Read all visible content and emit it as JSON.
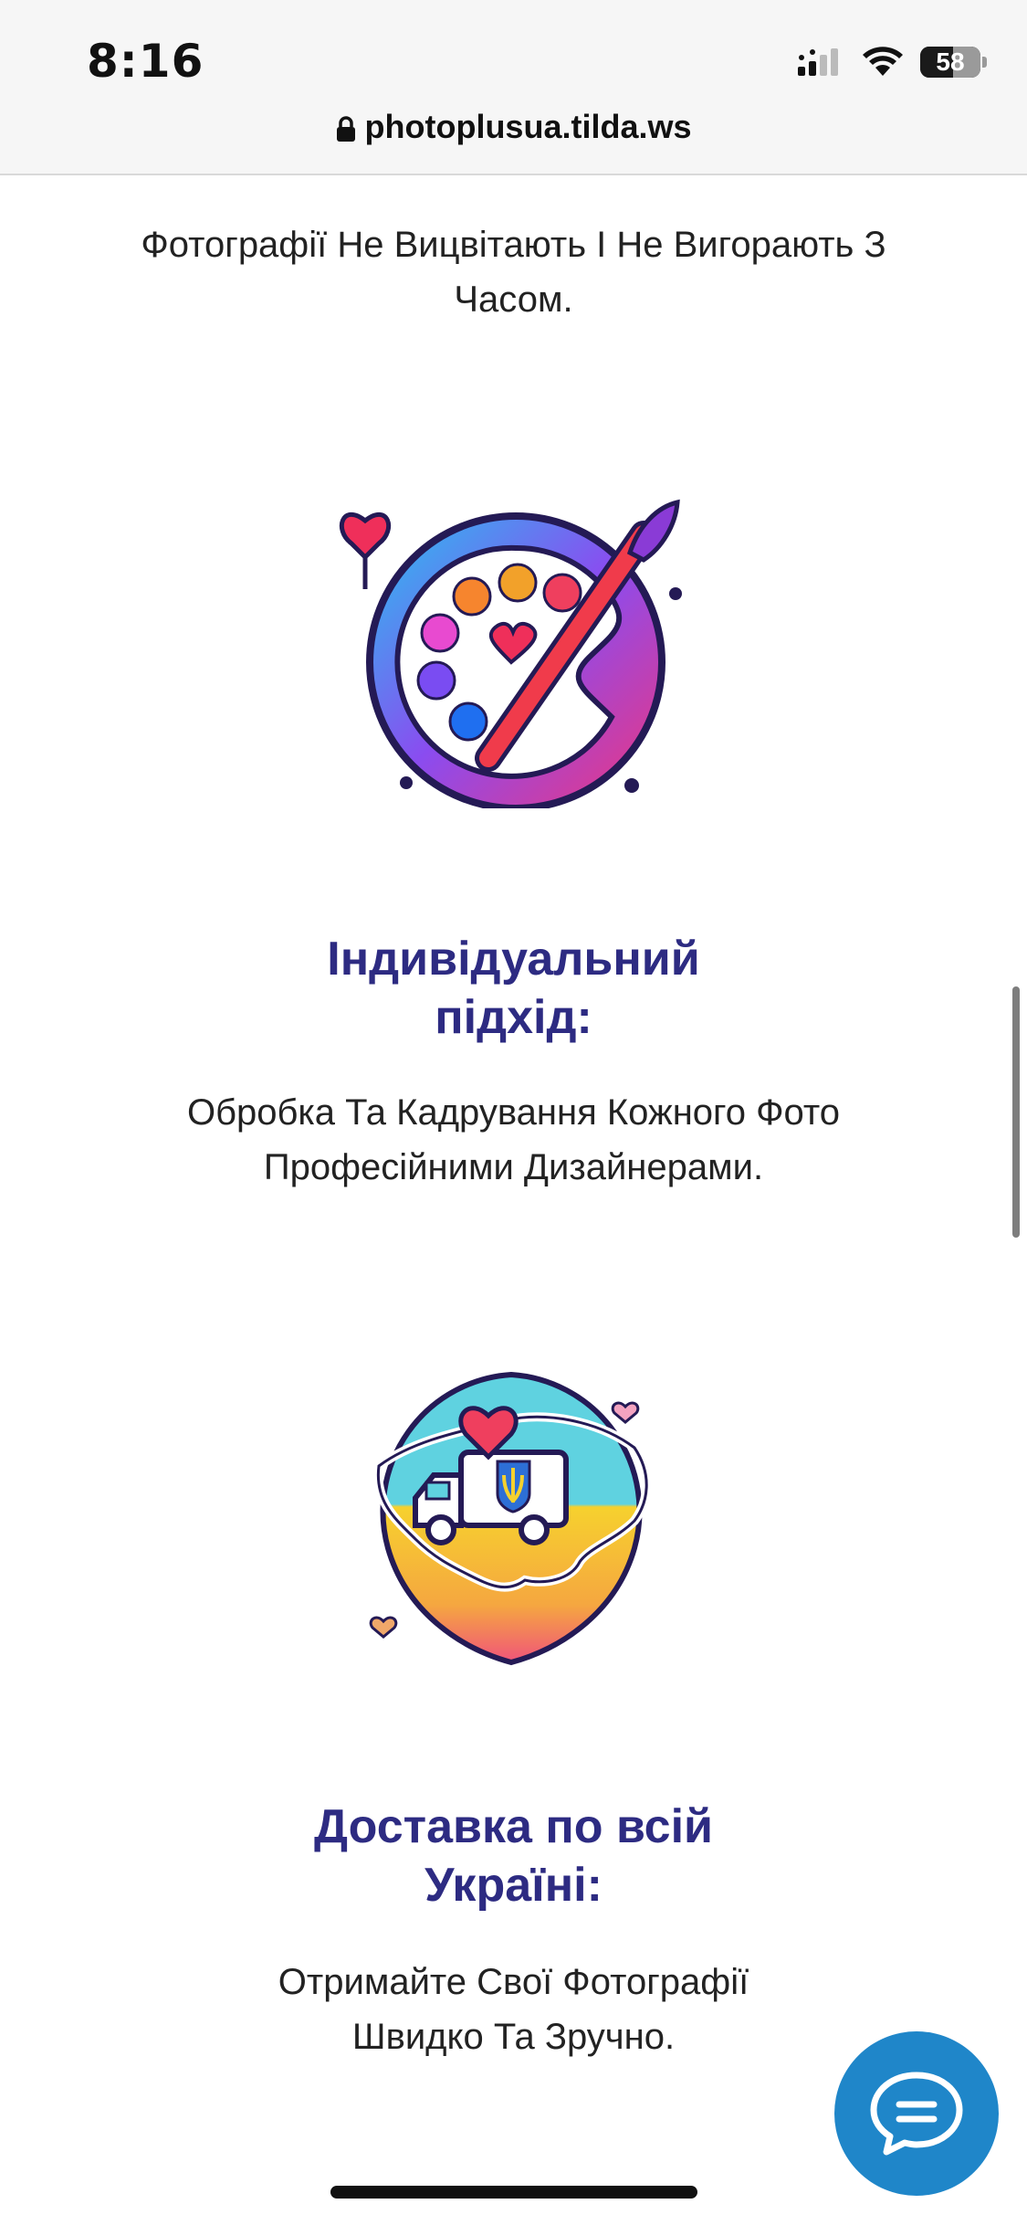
{
  "status_bar": {
    "time": "8:16",
    "battery": "58"
  },
  "browser": {
    "url": "photoplusua.tilda.ws"
  },
  "sections": [
    {
      "text": "Фотографії Не Вицвітають І Не Вигорають З Часом."
    },
    {
      "title": "Індивідуальний підхід:",
      "text": "Обробка Та Кадрування Кожного Фото Професійними Дизайнерами.",
      "icon": "palette-icon"
    },
    {
      "title": "Доставка по всій Україні:",
      "text": "Отримайте Свої Фотографії Швидко Та Зручно.",
      "icon": "ukraine-delivery-icon"
    }
  ],
  "colors": {
    "title": "#2d2b82",
    "chat_button": "#1f86c9"
  }
}
